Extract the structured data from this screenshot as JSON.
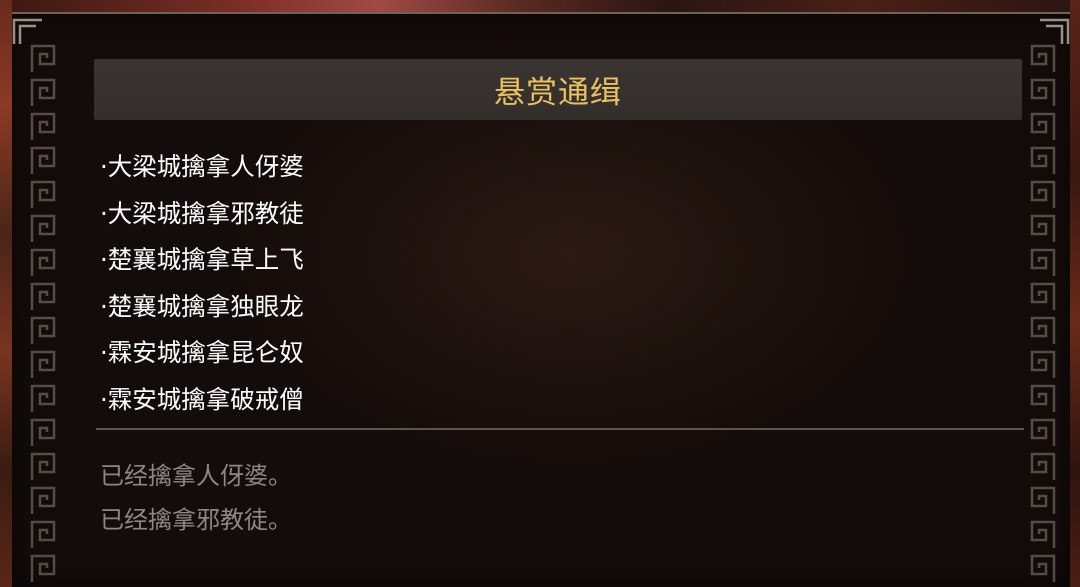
{
  "title": "悬赏通缉",
  "bounties": [
    {
      "text": "·大梁城擒拿人伢婆"
    },
    {
      "text": "·大梁城擒拿邪教徒"
    },
    {
      "text": "·楚襄城擒拿草上飞"
    },
    {
      "text": "·楚襄城擒拿独眼龙"
    },
    {
      "text": "·霖安城擒拿昆仑奴"
    },
    {
      "text": "·霖安城擒拿破戒僧"
    }
  ],
  "captured_log": [
    {
      "text": "已经擒拿人伢婆。"
    },
    {
      "text": "已经擒拿邪教徒。"
    }
  ],
  "colors": {
    "title": "#e9c163",
    "list_text": "#ffffff",
    "log_text": "#8c8783",
    "panel_bg": "#140d0a",
    "border_pattern": "#8a8276"
  },
  "icons": {
    "border": "greek-key-meander-border"
  }
}
